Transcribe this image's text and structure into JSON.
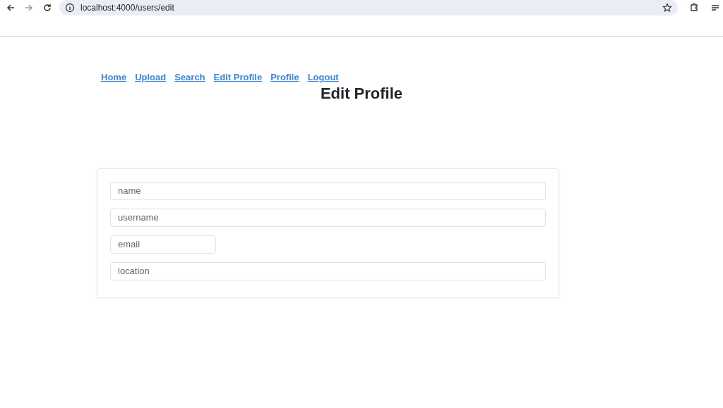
{
  "browser": {
    "url": "localhost:4000/users/edit"
  },
  "nav": [
    {
      "label": "Home"
    },
    {
      "label": "Upload"
    },
    {
      "label": "Search"
    },
    {
      "label": "Edit Profile"
    },
    {
      "label": "Profile"
    },
    {
      "label": "Logout"
    }
  ],
  "heading": "Edit Profile",
  "form": {
    "fields": [
      {
        "placeholder": "name",
        "kind": "wide"
      },
      {
        "placeholder": "username",
        "kind": "wide"
      },
      {
        "placeholder": "email",
        "kind": "short"
      },
      {
        "placeholder": "location",
        "kind": "wide"
      }
    ]
  }
}
